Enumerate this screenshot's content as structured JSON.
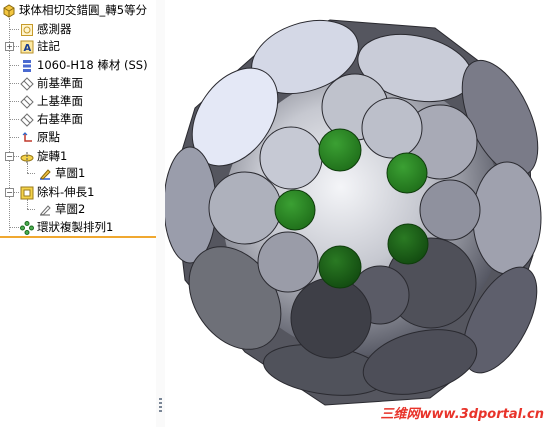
{
  "feature_tree": {
    "root": {
      "label": "球体相切交錯圓_轉5等分",
      "icon": "part-icon"
    },
    "items": [
      {
        "label": "感測器",
        "icon": "sensor-icon"
      },
      {
        "label": "註記",
        "icon": "annotation-icon"
      },
      {
        "label": "1060-H18 棒材 (SS)",
        "icon": "material-icon"
      },
      {
        "label": "前基準面",
        "icon": "plane-icon"
      },
      {
        "label": "上基準面",
        "icon": "plane-icon"
      },
      {
        "label": "右基準面",
        "icon": "plane-icon"
      },
      {
        "label": "原點",
        "icon": "origin-icon"
      },
      {
        "label": "旋轉1",
        "icon": "revolve-icon"
      },
      {
        "label": "草圖1",
        "icon": "sketch-icon"
      },
      {
        "label": "除料-伸長1",
        "icon": "cut-extrude-icon"
      },
      {
        "label": "草圖2",
        "icon": "sketch-icon"
      },
      {
        "label": "環狀複製排列1",
        "icon": "circular-pattern-icon"
      }
    ]
  },
  "viewport": {
    "model": "sphere-with-tangent-circles",
    "colors": {
      "sphere_light": "#e6e8ee",
      "sphere_dark": "#4a4c58",
      "highlight": "#2f8f2a",
      "accent_border": "#f0a830"
    }
  },
  "watermark": "三维网www.3dportal.cn"
}
